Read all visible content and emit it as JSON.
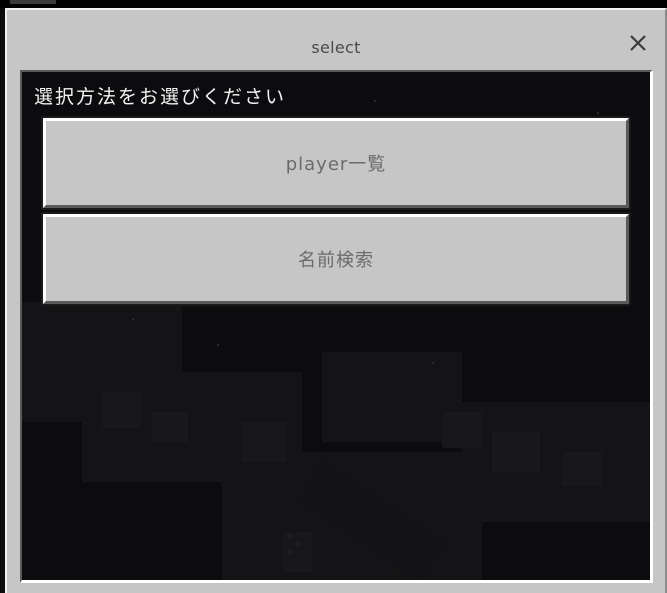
{
  "dialog": {
    "title": "select",
    "close_icon": "close-icon"
  },
  "content": {
    "prompt": "選択方法をお選びください",
    "buttons": [
      {
        "label": "player一覧"
      },
      {
        "label": "名前検索"
      }
    ]
  },
  "colors": {
    "panel": "#c6c6c6",
    "button": "#c6c6c6",
    "button_text": "#6b6b6b",
    "prompt_text": "#f2f2f2",
    "background": "#0d0d0f"
  }
}
